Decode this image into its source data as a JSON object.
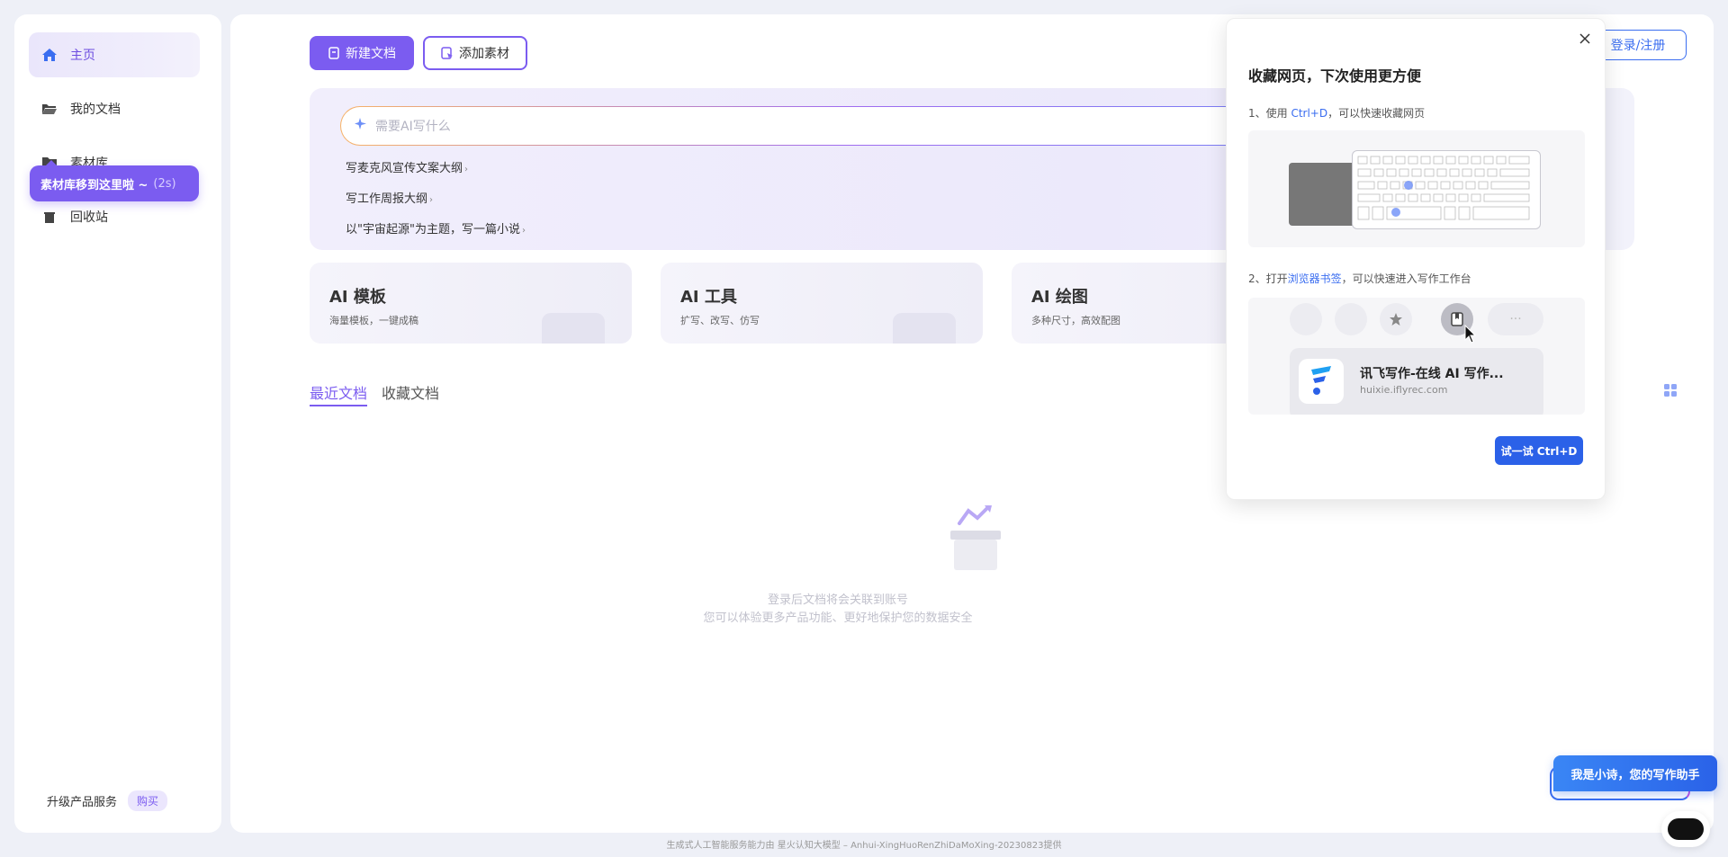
{
  "sidebar": {
    "items": [
      {
        "label": "主页",
        "icon": "home-icon"
      },
      {
        "label": "我的文档",
        "icon": "folder-open-icon"
      },
      {
        "label": "素材库",
        "icon": "folder-icon"
      },
      {
        "label": "回收站",
        "icon": "trash-icon"
      }
    ],
    "tooltip": {
      "text": "素材库移到这里啦 ~",
      "countdown": "(2s)"
    },
    "upgrade_label": "升级产品服务",
    "buy_label": "购买"
  },
  "toolbar": {
    "new_doc_label": "新建文档",
    "add_material_label": "添加素材",
    "login_label": "登录/注册"
  },
  "ai_box": {
    "placeholder": "需要AI写什么",
    "suggestions": [
      "写麦克风宣传文案大纲",
      "写工作周报大纲",
      "以\"宇宙起源\"为主题，写一篇小说"
    ]
  },
  "cards": [
    {
      "title": "AI 模板",
      "desc": "海量模板，一键成稿"
    },
    {
      "title": "AI 工具",
      "desc": "扩写、改写、仿写"
    },
    {
      "title": "AI 绘图",
      "desc": "多种尺寸，高效配图"
    }
  ],
  "tabs": {
    "recent": "最近文档",
    "favorite": "收藏文档"
  },
  "empty": {
    "line1": "登录后文档将会关联到账号",
    "line2": "您可以体验更多产品功能、更好地保护您的数据安全"
  },
  "popup": {
    "title": "收藏网页，下次使用更方便",
    "step1_prefix": "1、使用 ",
    "step1_key": "Ctrl+D",
    "step1_suffix": "，可以快速收藏网页",
    "step2_prefix": "2、打开",
    "step2_link": "浏览器书签",
    "step2_suffix": "，可以快速进入写作工作台",
    "bookmark_title": "讯飞写作-在线 AI 写作...",
    "bookmark_url": "huixie.iflyrec.com",
    "try_label": "试一试 Ctrl+D"
  },
  "assistant": {
    "label": "我是小诗，您的写作助手"
  },
  "footer": "生成式人工智能服务能力由 星火认知大模型 – Anhui-XingHuoRenZhiDaMoXing-20230823提供",
  "colors": {
    "accent": "#7b5cf0",
    "link": "#3a6df0",
    "primary_button": "#2b61e8"
  }
}
